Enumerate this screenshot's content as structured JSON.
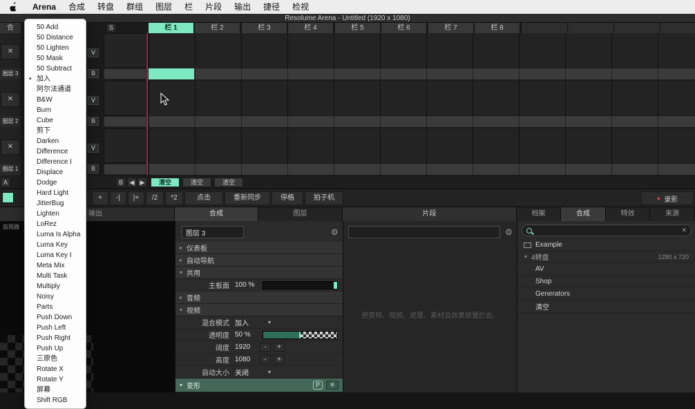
{
  "glyphs": {
    "bullet": "•",
    "close": "✕",
    "collapsed": "▸",
    "expanded": "▾",
    "caret": "▾",
    "prev": "◀",
    "next": "▶",
    "gear": "⚙",
    "record_dot": "●",
    "hamburger": "≡",
    "search_clear": "✕"
  },
  "menubar": {
    "items": [
      "Arena",
      "合成",
      "转盘",
      "群组",
      "图层",
      "栏",
      "片段",
      "输出",
      "捷径",
      "检视"
    ]
  },
  "titlebar": {
    "title": "Resolume Arena - Untitled (1920 x 1080)"
  },
  "blend_menu": {
    "checked_item": "加入",
    "items": [
      "50 Add",
      "50 Distance",
      "50 Lighten",
      "50 Mask",
      "50 Subtract",
      "加入",
      "阿尔法通道",
      "B&W",
      "Burn",
      "Cube",
      "剪下",
      "Darken",
      "Difference",
      "Difference I",
      "Displace",
      "Dodge",
      "Hard Light",
      "JitterBug",
      "Lighten",
      "LoRez",
      "Luma Is Alpha",
      "Luma Key",
      "Luma Key I",
      "Meta Mix",
      "Multi Task",
      "Multiply",
      "Noisy",
      "Parts",
      "Push Down",
      "Push Left",
      "Push Right",
      "Push Up",
      "三原色",
      "Rotate X",
      "Rotate Y",
      "屏幕",
      "Shift RGB"
    ]
  },
  "grid": {
    "corner": "合",
    "solo": "S",
    "columns": [
      "栏 1",
      "栏 2",
      "栏 3",
      "栏 4",
      "栏 5",
      "栏 6",
      "栏 7",
      "栏 8"
    ],
    "active_column": "栏 1",
    "layers": [
      {
        "name": "图层 3",
        "video": "V",
        "bypass": "B"
      },
      {
        "name": "图层 2",
        "video": "V",
        "bypass": "B"
      },
      {
        "name": "图层 1",
        "video": "V",
        "bypass": "B"
      }
    ]
  },
  "crossfader": {
    "a": "A",
    "b": "B",
    "clear_buttons": [
      "清空",
      "清空",
      "清空"
    ]
  },
  "transport": {
    "buttons": [
      "+",
      "-|",
      "|+",
      "/2",
      "*2",
      "点击",
      "重新同步",
      "停格",
      "拍子机"
    ],
    "record_label": "录影"
  },
  "tabs": {
    "monitor": "输出",
    "composition": "合成",
    "layer": "图层",
    "clip": "片段",
    "browser": [
      "档案",
      "合成",
      "特效",
      "来源"
    ]
  },
  "monitor": {
    "label": "监视器"
  },
  "composition": {
    "name_value": "图层 3",
    "sections": {
      "dashboard": "仪表板",
      "autopilot": "自动导航",
      "common": "共用",
      "audio": "音频",
      "video": "视频",
      "transform": "变形"
    },
    "params": {
      "master_label": "主板面",
      "master_value": "100 %",
      "blend_label": "混合模式",
      "blend_value": "加入",
      "opacity_label": "透明度",
      "opacity_value": "50 %",
      "width_label": "阔度",
      "width_value": "1920",
      "height_label": "高度",
      "height_value": "1080",
      "autosize_label": "自动大小",
      "autosize_value": "关闭",
      "minus": "-",
      "plus": "+"
    },
    "transform_p": "P"
  },
  "clip": {
    "hint": "把音频、视频、遮罩、素材及效果放置於此。"
  },
  "browser": {
    "example": {
      "label": "Example",
      "deck_info": "4转盘",
      "resolution": "1280 x 720"
    },
    "folders": [
      "AV",
      "Shop",
      "Generators",
      "清空"
    ]
  },
  "colors": {
    "accent": "#7de8c2",
    "record": "#e04040"
  }
}
